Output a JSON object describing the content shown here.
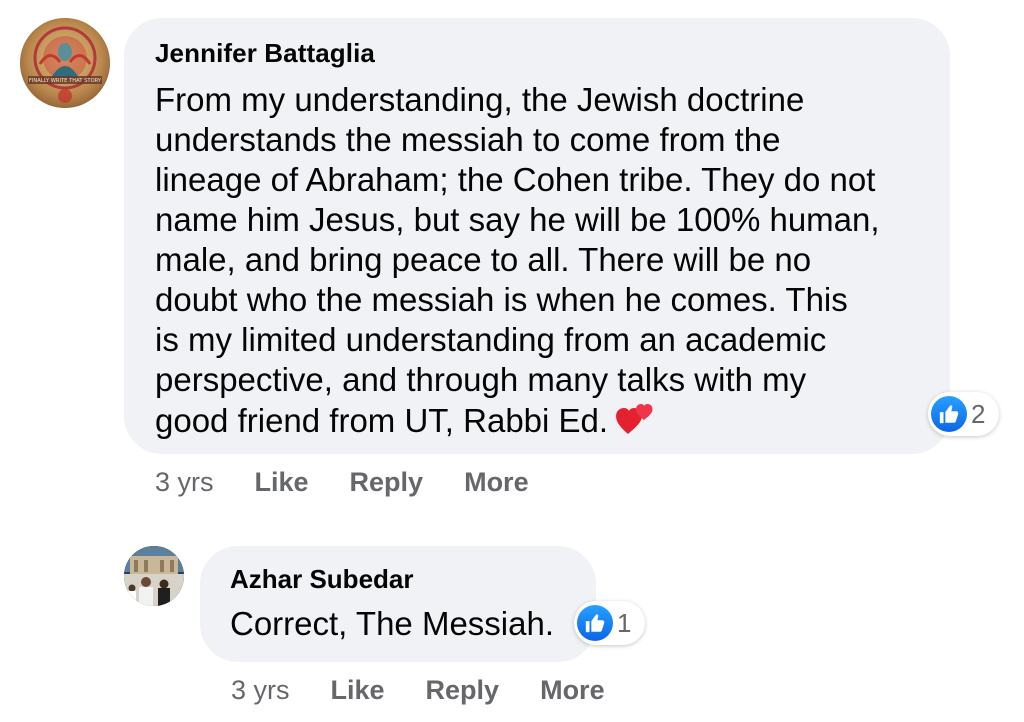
{
  "comments": [
    {
      "author": "Jennifer Battaglia",
      "avatar_icon": "avatar-illustration-icon",
      "avatar_caption": "FINALLY WRITE THAT STORY",
      "text_lines": [
        "From my understanding, the Jewish doctrine",
        "understands the messiah to come from the",
        "lineage of Abraham; the Cohen tribe. They do not",
        "name him Jesus, but say he will be 100% human,",
        "male, and bring peace to all. There will be no",
        "doubt who the messiah is when he comes. This",
        "is my limited understanding from an academic",
        "perspective, and through many talks with my",
        "good friend from UT, Rabbi Ed."
      ],
      "emoji_icon": "two-hearts-icon",
      "reaction_icon": "like-icon",
      "reaction_count": "2",
      "time": "3 yrs",
      "like_label": "Like",
      "reply_label": "Reply",
      "more_label": "More"
    },
    {
      "author": "Azhar Subedar",
      "avatar_icon": "avatar-photo-icon",
      "text": "Correct, The Messiah.",
      "reaction_icon": "like-icon",
      "reaction_count": "1",
      "time": "3 yrs",
      "like_label": "Like",
      "reply_label": "Reply",
      "more_label": "More"
    }
  ],
  "colors": {
    "bubble": "#f0f2f5",
    "text": "#050505",
    "meta": "#65676b",
    "like_blue": "#1877f2",
    "heart_red": "#e4222f"
  }
}
